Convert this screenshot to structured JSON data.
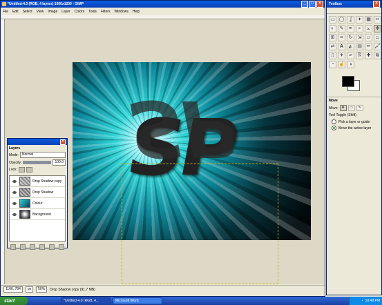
{
  "main_window": {
    "title": "*Untitled-4.0 (RGB, 4 layers) 1600x1200 - GIMP",
    "menu": [
      "File",
      "Edit",
      "Select",
      "View",
      "Image",
      "Layer",
      "Colors",
      "Tools",
      "Filters",
      "Windows",
      "Help"
    ],
    "canvas_text_top": "SP",
    "canvas_text_reflection": "SP",
    "status": {
      "coords": "1166, 784",
      "unit": "px",
      "zoom": "50%",
      "message": "Drop Shadow copy (91.7 MB)"
    }
  },
  "layers_dialog": {
    "title": "Layers",
    "mode_label": "Mode:",
    "mode_value": "Normal",
    "opacity_label": "Opacity:",
    "opacity_value": "100.0",
    "lock_label": "Lock:",
    "layers": [
      {
        "name": "Drop Shadow copy"
      },
      {
        "name": "Drop Shadow"
      },
      {
        "name": "Colour"
      },
      {
        "name": "Background"
      }
    ]
  },
  "toolbox": {
    "title": "Toolbox",
    "tool_options": {
      "title": "Move",
      "move_label": "Move:",
      "toggle_label": "Tool Toggle (Shift)",
      "options": [
        {
          "label": "Pick a layer or guide",
          "selected": false
        },
        {
          "label": "Move the active layer",
          "selected": true
        }
      ]
    }
  },
  "taskbar": {
    "start_label": "start",
    "tasks": [
      {
        "label": "*Untitled-4.0 (RGB, 4...",
        "active": true
      },
      {
        "label": "Microsoft Word",
        "active": false
      }
    ],
    "clock": "10:49 PM"
  },
  "colors": {
    "titlebar": "#0841b8",
    "canvas_cyan": "#2fd4d7",
    "selection_dash": "#c8b400"
  }
}
